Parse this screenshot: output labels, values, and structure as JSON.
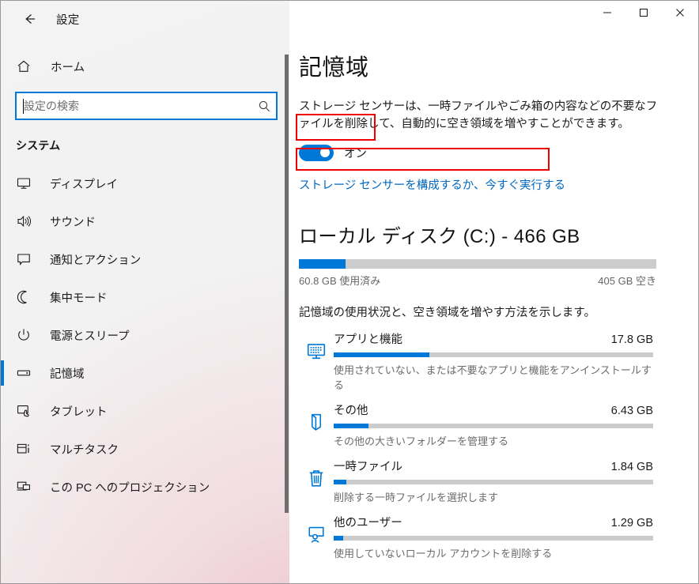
{
  "window": {
    "titlebar": {
      "minimize_label": "─",
      "maximize_label": "□",
      "close_label": "✕"
    }
  },
  "sidebar": {
    "back_icon": "back-arrow-icon",
    "app_title": "設定",
    "home": {
      "label": "ホーム",
      "icon": "home-icon"
    },
    "search": {
      "placeholder": "設定の検索",
      "value": "",
      "icon": "search-icon"
    },
    "group_title": "システム",
    "items": [
      {
        "label": "ディスプレイ",
        "icon": "monitor-icon",
        "selected": false
      },
      {
        "label": "サウンド",
        "icon": "speaker-icon",
        "selected": false
      },
      {
        "label": "通知とアクション",
        "icon": "chat-bubble-icon",
        "selected": false
      },
      {
        "label": "集中モード",
        "icon": "moon-icon",
        "selected": false
      },
      {
        "label": "電源とスリープ",
        "icon": "power-icon",
        "selected": false
      },
      {
        "label": "記憶域",
        "icon": "storage-icon",
        "selected": true
      },
      {
        "label": "タブレット",
        "icon": "tablet-icon",
        "selected": false
      },
      {
        "label": "マルチタスク",
        "icon": "multitask-icon",
        "selected": false
      },
      {
        "label": "この PC へのプロジェクション",
        "icon": "projection-icon",
        "selected": false
      }
    ]
  },
  "main": {
    "page_title": "記憶域",
    "storage_sense": {
      "description": "ストレージ センサーは、一時ファイルやごみ箱の内容などの不要なファイルを削除して、自動的に空き領域を増やすことができます。",
      "toggle_state": "オン",
      "toggle_on": true,
      "config_link": "ストレージ センサーを構成するか、今すぐ実行する"
    },
    "drive": {
      "title": "ローカル ディスク (C:) - 466 GB",
      "used_label": "60.8 GB 使用済み",
      "free_label": "405 GB 空き",
      "used_percent": 13
    },
    "section_note": "記憶域の使用状況と、空き領域を増やす方法を示します。",
    "storage_items": [
      {
        "name": "アプリと機能",
        "size": "17.8 GB",
        "percent": 30,
        "sub": "使用されていない、または不要なアプリと機能をアンインストールする",
        "icon": "apps-monitor-icon"
      },
      {
        "name": "その他",
        "size": "6.43 GB",
        "percent": 11,
        "sub": "その他の大きいフォルダーを管理する",
        "icon": "folder-icon"
      },
      {
        "name": "一時ファイル",
        "size": "1.84 GB",
        "percent": 4,
        "sub": "削除する一時ファイルを選択します",
        "icon": "trash-icon"
      },
      {
        "name": "他のユーザー",
        "size": "1.29 GB",
        "percent": 3,
        "sub": "使用していないローカル アカウントを削除する",
        "icon": "user-monitor-icon"
      }
    ]
  },
  "annotations": {
    "color": "#ee0000",
    "boxes": [
      {
        "name": "toggle-highlight"
      },
      {
        "name": "link-highlight"
      }
    ]
  },
  "colors": {
    "accent": "#0078d7",
    "link": "#0067c0",
    "track": "#cccccc",
    "annotation": "#ee0000"
  }
}
